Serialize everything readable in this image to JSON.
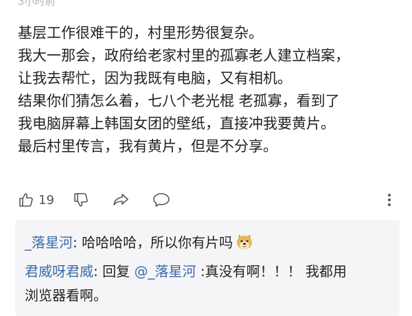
{
  "post": {
    "timestamp": "3小时前",
    "lines": [
      "基层工作很难干的，村里形势很复杂。",
      "我大一那会，政府给老家村里的孤寡老人建立档案，",
      "让我去帮忙，因为我既有电脑，又有相机。",
      "结果你们猜怎么着，七八个老光棍 老孤寡，看到了",
      "我电脑屏幕上韩国女团的壁纸，直接冲我要黄片。",
      "最后村里传言，我有黄片，但是不分享。"
    ]
  },
  "actions": {
    "like_count": "19"
  },
  "replies": [
    {
      "user": "_落星河",
      "separator": ": ",
      "text": "哈哈哈哈，所以你有片吗",
      "emoji": "doge-emoji"
    },
    {
      "user": "君威呀君威",
      "separator": ": ",
      "reply_label": "回复 ",
      "mention": "@_落星河",
      "text": " :真没有啊！！！ 我都用",
      "continuation": "浏览器看啊。"
    }
  ],
  "colors": {
    "link": "#3c6ca8",
    "text": "#222222",
    "muted": "#b3b3b3",
    "reply_bg": "#f5f5f7"
  }
}
